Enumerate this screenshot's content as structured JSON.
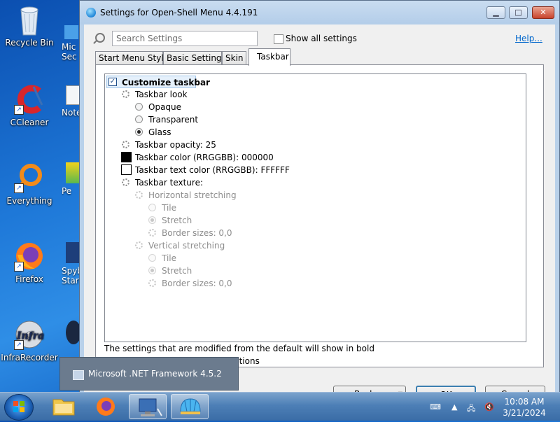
{
  "desktop": {
    "icons": [
      {
        "label": "Recycle Bin",
        "icon": "recycle-bin-icon"
      },
      {
        "label": "CCleaner",
        "icon": "ccleaner-icon"
      },
      {
        "label": "Everything",
        "icon": "everything-icon"
      },
      {
        "label": "Firefox",
        "icon": "firefox-icon"
      },
      {
        "label": "InfraRecorder",
        "icon": "infrarecorder-icon"
      }
    ],
    "cut_icons": [
      "Mic",
      "Sec",
      "Note",
      "Pe",
      "Spyb",
      "Start"
    ]
  },
  "window": {
    "title": "Settings for Open-Shell Menu 4.4.191",
    "search_placeholder": "Search Settings",
    "show_all_label": "Show all settings",
    "help_label": "Help...",
    "tabs": [
      {
        "label": "Start Menu Style",
        "active": false
      },
      {
        "label": "Basic Settings",
        "active": false
      },
      {
        "label": "Skin",
        "active": false
      },
      {
        "label": "Taskbar",
        "active": true
      }
    ],
    "tree": {
      "customize_taskbar": "Customize taskbar",
      "taskbar_look": "Taskbar look",
      "opaque": "Opaque",
      "transparent": "Transparent",
      "glass": "Glass",
      "opacity": "Taskbar opacity: 25",
      "color": "Taskbar color (RRGGBB): 000000",
      "text_color": "Taskbar text color (RRGGBB): FFFFFF",
      "texture": "Taskbar texture:",
      "horizontal_stretching": "Horizontal stretching",
      "h_tile": "Tile",
      "h_stretch": "Stretch",
      "h_border": "Border sizes: 0,0",
      "vertical_stretching": "Vertical stretching",
      "v_tile": "Tile",
      "v_stretch": "Stretch",
      "v_border": "Border sizes: 0,0"
    },
    "status_line_1": "The settings that are modified from the default will show in bold",
    "status_line_2": "ctions",
    "backup_label": "Backup",
    "ok_label": "OK",
    "cancel_label": "Cancel"
  },
  "popup": {
    "label": "Microsoft .NET Framework 4.5.2"
  },
  "taskbar": {
    "time": "10:08 AM",
    "date": "3/21/2024"
  },
  "colors": {
    "swatch_taskbar": "#000000",
    "swatch_text": "#FFFFFF"
  }
}
